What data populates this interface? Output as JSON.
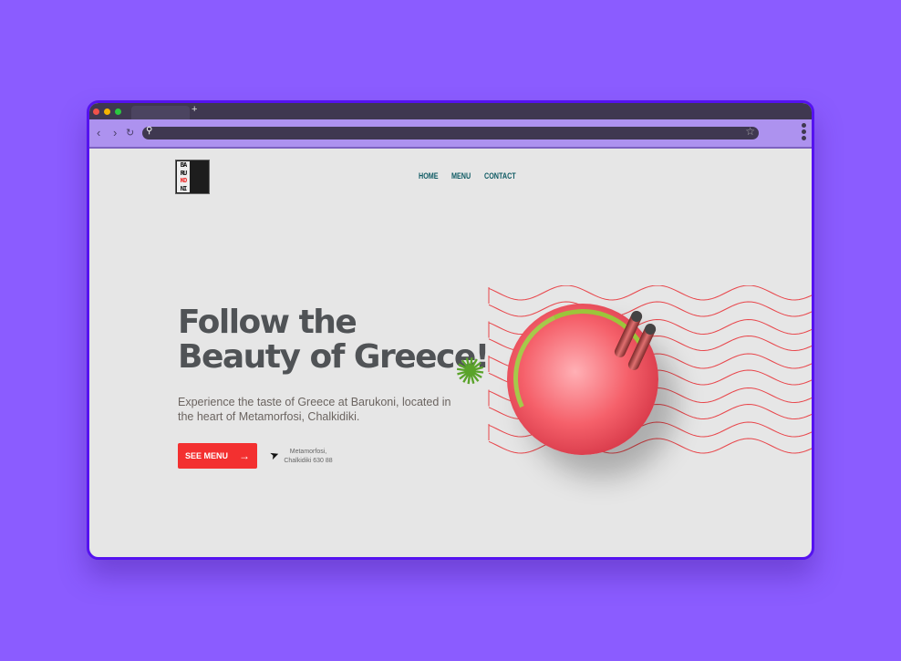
{
  "browser": {
    "new_tab": "+",
    "url": ""
  },
  "logo": {
    "letters": [
      "BA",
      "RU",
      "KO",
      "NI"
    ]
  },
  "nav": [
    {
      "label": "HOME"
    },
    {
      "label": "MENU"
    },
    {
      "label": "CONTACT"
    }
  ],
  "hero": {
    "title_line1": "Follow the",
    "title_line2": "Beauty of Greece!",
    "description": "Experience the taste of Greece at Barukoni, located in the heart of Metamorfosi, Chalkidiki.",
    "cta": "SEE MENU",
    "address_line1": "Metamorfosi,",
    "address_line2": "Chalkidiki 630 88"
  },
  "colors": {
    "accent": "#f33030",
    "wave": "#e8454a",
    "nav": "#0e5a63"
  }
}
